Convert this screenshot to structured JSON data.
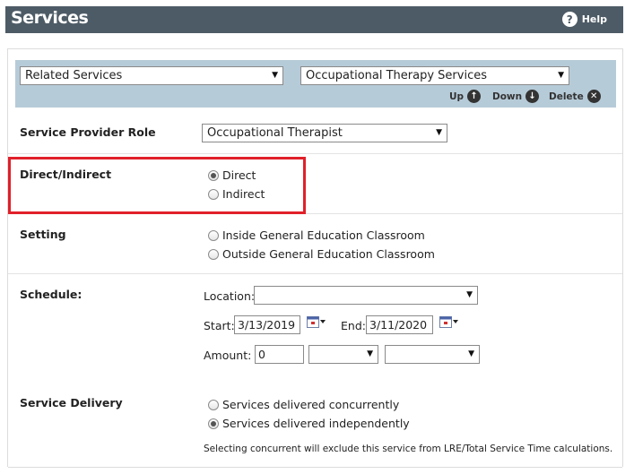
{
  "header": {
    "title": "Services",
    "help_label": "Help"
  },
  "toolbar": {
    "category_select": "Related Services",
    "service_select": "Occupational Therapy Services",
    "up_label": "Up",
    "down_label": "Down",
    "delete_label": "Delete"
  },
  "provider_role": {
    "label": "Service Provider Role",
    "value": "Occupational Therapist"
  },
  "direct_indirect": {
    "label": "Direct/Indirect",
    "options": [
      {
        "label": "Direct",
        "checked": true
      },
      {
        "label": "Indirect",
        "checked": false
      }
    ]
  },
  "setting": {
    "label": "Setting",
    "options": [
      {
        "label": "Inside General Education Classroom",
        "checked": false
      },
      {
        "label": "Outside General Education Classroom",
        "checked": false
      }
    ]
  },
  "schedule": {
    "label": "Schedule:",
    "location_label": "Location:",
    "location_value": "",
    "start_label": "Start:",
    "start_value": "3/13/2019",
    "end_label": "End:",
    "end_value": "3/11/2020",
    "amount_label": "Amount:",
    "amount_value": "0",
    "amount_unit_value": "",
    "amount_freq_value": ""
  },
  "service_delivery": {
    "label": "Service Delivery",
    "options": [
      {
        "label": "Services delivered concurrently",
        "checked": false
      },
      {
        "label": "Services delivered independently",
        "checked": true
      }
    ],
    "note": "Selecting concurrent will exclude this service from LRE/Total Service Time calculations."
  }
}
